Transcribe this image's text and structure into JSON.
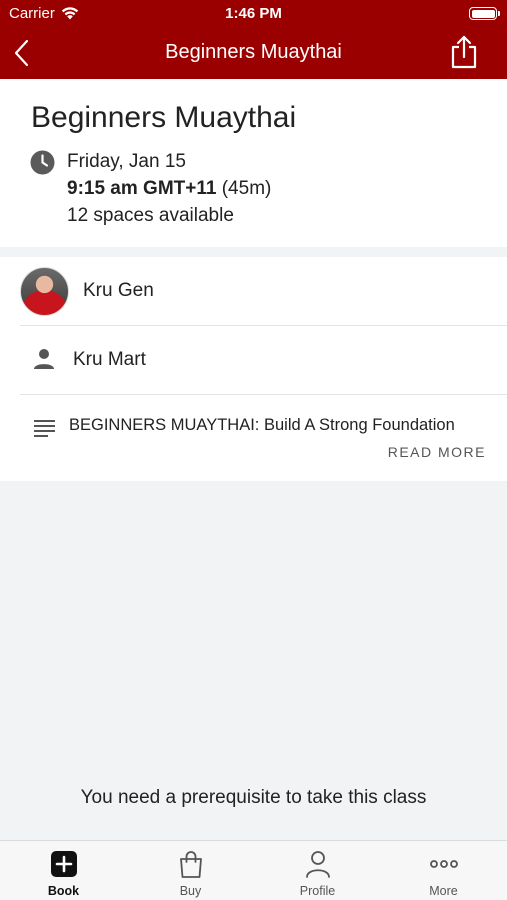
{
  "status_bar": {
    "carrier": "Carrier",
    "time": "1:46 PM",
    "battery_level": 1.0
  },
  "nav": {
    "title": "Beginners Muaythai",
    "back_icon": "chevron-left-icon",
    "share_icon": "share-icon",
    "color": "#9b0000"
  },
  "class": {
    "title": "Beginners Muaythai",
    "date": "Friday, Jan 15",
    "time": "9:15 am GMT+11",
    "duration": "(45m)",
    "spaces": "12 spaces available"
  },
  "instructors": [
    {
      "name": "Kru Gen",
      "has_photo": true
    },
    {
      "name": "Kru Mart",
      "has_photo": false
    }
  ],
  "description": {
    "text": "BEGINNERS MUAYTHAI: Build A Strong Foundation",
    "read_more": "READ MORE"
  },
  "prerequisite_message": "You need a prerequisite to take this class",
  "tabs": [
    {
      "label": "Book",
      "icon": "plus-square-icon",
      "active": true
    },
    {
      "label": "Buy",
      "icon": "shopping-bag-icon",
      "active": false
    },
    {
      "label": "Profile",
      "icon": "person-icon",
      "active": false
    },
    {
      "label": "More",
      "icon": "more-dots-icon",
      "active": false
    }
  ]
}
